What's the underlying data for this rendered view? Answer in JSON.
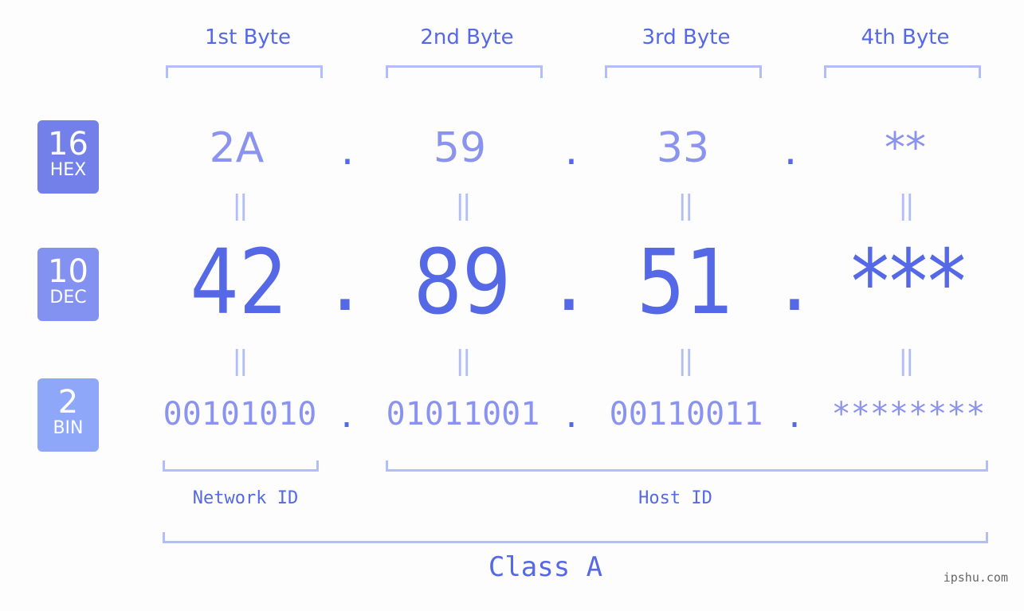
{
  "byte_headers": [
    "1st Byte",
    "2nd Byte",
    "3rd Byte",
    "4th Byte"
  ],
  "bases": [
    {
      "number": "16",
      "label": "HEX",
      "color": "#7480ea"
    },
    {
      "number": "10",
      "label": "DEC",
      "color": "#8391f0"
    },
    {
      "number": "2",
      "label": "BIN",
      "color": "#8fa7f8"
    }
  ],
  "hex_values": [
    "2A",
    "59",
    "33",
    "**"
  ],
  "dec_values": [
    "42",
    "89",
    "51",
    "***"
  ],
  "bin_values": [
    "00101010",
    "01011001",
    "00110011",
    "********"
  ],
  "separator": ".",
  "equals_sign": "||",
  "network_label": "Network ID",
  "host_label": "Host ID",
  "class_label": "Class A",
  "watermark": "ipshu.com",
  "colors": {
    "accent": "#5568e6",
    "light_text": "#8a93ee",
    "bracket": "#b3bdf8"
  }
}
